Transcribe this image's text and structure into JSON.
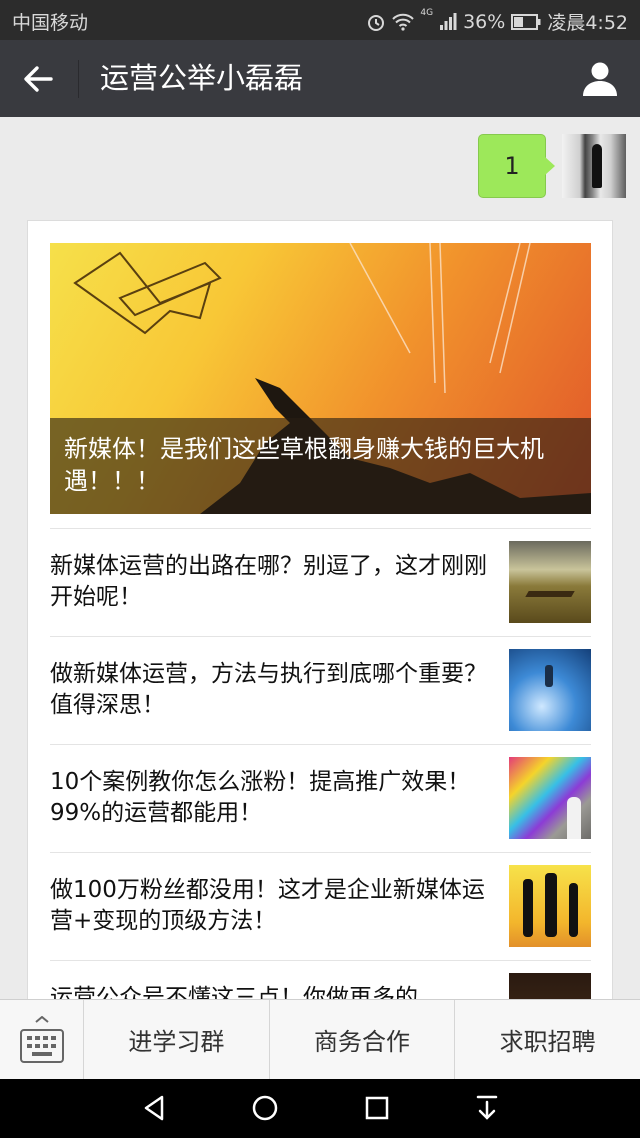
{
  "status_bar": {
    "carrier": "中国移动",
    "network": "4G",
    "battery": "36%",
    "time": "凌晨4:52",
    "icons": [
      "alarm-icon",
      "wifi-icon",
      "signal-icon",
      "battery-icon"
    ]
  },
  "nav": {
    "title": "运营公举小磊磊",
    "back_icon": "arrow-left-icon",
    "profile_icon": "user-icon"
  },
  "message": {
    "text": "1",
    "bubble_color": "#9de85a"
  },
  "feed": {
    "hero_title": "新媒体！是我们这些草根翻身赚大钱的巨大机遇！！！",
    "articles": [
      {
        "title": "新媒体运营的出路在哪？别逗了，这才刚刚开始呢！"
      },
      {
        "title": "做新媒体运营，方法与执行到底哪个重要？值得深思！"
      },
      {
        "title": "10个案例教你怎么涨粉！提高推广效果！99%的运营都能用！"
      },
      {
        "title": "做100万粉丝都没用！这才是企业新媒体运营+变现的顶级方法！"
      },
      {
        "title": "运营公众号不懂这三点！你做再多的"
      }
    ]
  },
  "bottom_menu": {
    "keyboard_icon": "keyboard-icon",
    "items": [
      "进学习群",
      "商务合作",
      "求职招聘"
    ]
  },
  "android_nav": {
    "icons": [
      "back-triangle-icon",
      "home-circle-icon",
      "recents-square-icon",
      "notification-pull-icon"
    ]
  },
  "colors": {
    "status_bar": "#2c2c2c",
    "nav_bar": "#393a3f",
    "background": "#ebebeb",
    "bubble": "#9de85a"
  }
}
